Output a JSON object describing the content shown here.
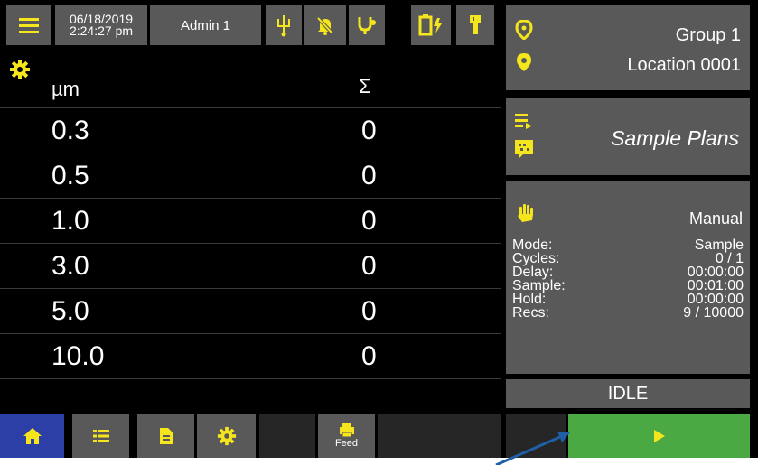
{
  "colors": {
    "accent_yellow": "#f5e51c",
    "panel_gray": "#595959",
    "home_blue": "#2b3fa6",
    "start_green": "#4aa943",
    "annotation_arrow": "#1f5fa6"
  },
  "header": {
    "menu_icon": "hamburger-menu-icon",
    "date": "06/18/2019",
    "time": "2:24:27 pm",
    "user": "Admin 1",
    "status_icons": [
      "usb-icon",
      "alarm-off-icon",
      "pump-icon",
      "battery-charging-icon",
      "flashlight-icon"
    ]
  },
  "counts": {
    "header_size": "µm",
    "header_sum": "Σ",
    "rows": [
      {
        "size": "0.3",
        "count": "0"
      },
      {
        "size": "0.5",
        "count": "0"
      },
      {
        "size": "1.0",
        "count": "0"
      },
      {
        "size": "3.0",
        "count": "0"
      },
      {
        "size": "5.0",
        "count": "0"
      },
      {
        "size": "10.0",
        "count": "0"
      }
    ]
  },
  "location": {
    "group": "Group 1",
    "location": "Location 0001"
  },
  "sample_plans": {
    "label": "Sample Plans"
  },
  "info": {
    "mode_label": "Manual",
    "rows": [
      {
        "label": "Mode:",
        "value": "Sample"
      },
      {
        "label": "Cycles:",
        "value": "0 / 1"
      },
      {
        "label": "Delay:",
        "value": "00:00:00"
      },
      {
        "label": "Sample:",
        "value": "00:01:00"
      },
      {
        "label": "Hold:",
        "value": "00:00:00"
      },
      {
        "label": "Recs:",
        "value": "9 / 10000"
      }
    ]
  },
  "status": "IDLE",
  "nav": {
    "items": [
      "home-icon",
      "list-icon",
      "document-icon",
      "settings-icon"
    ],
    "feed_label": "Feed"
  }
}
